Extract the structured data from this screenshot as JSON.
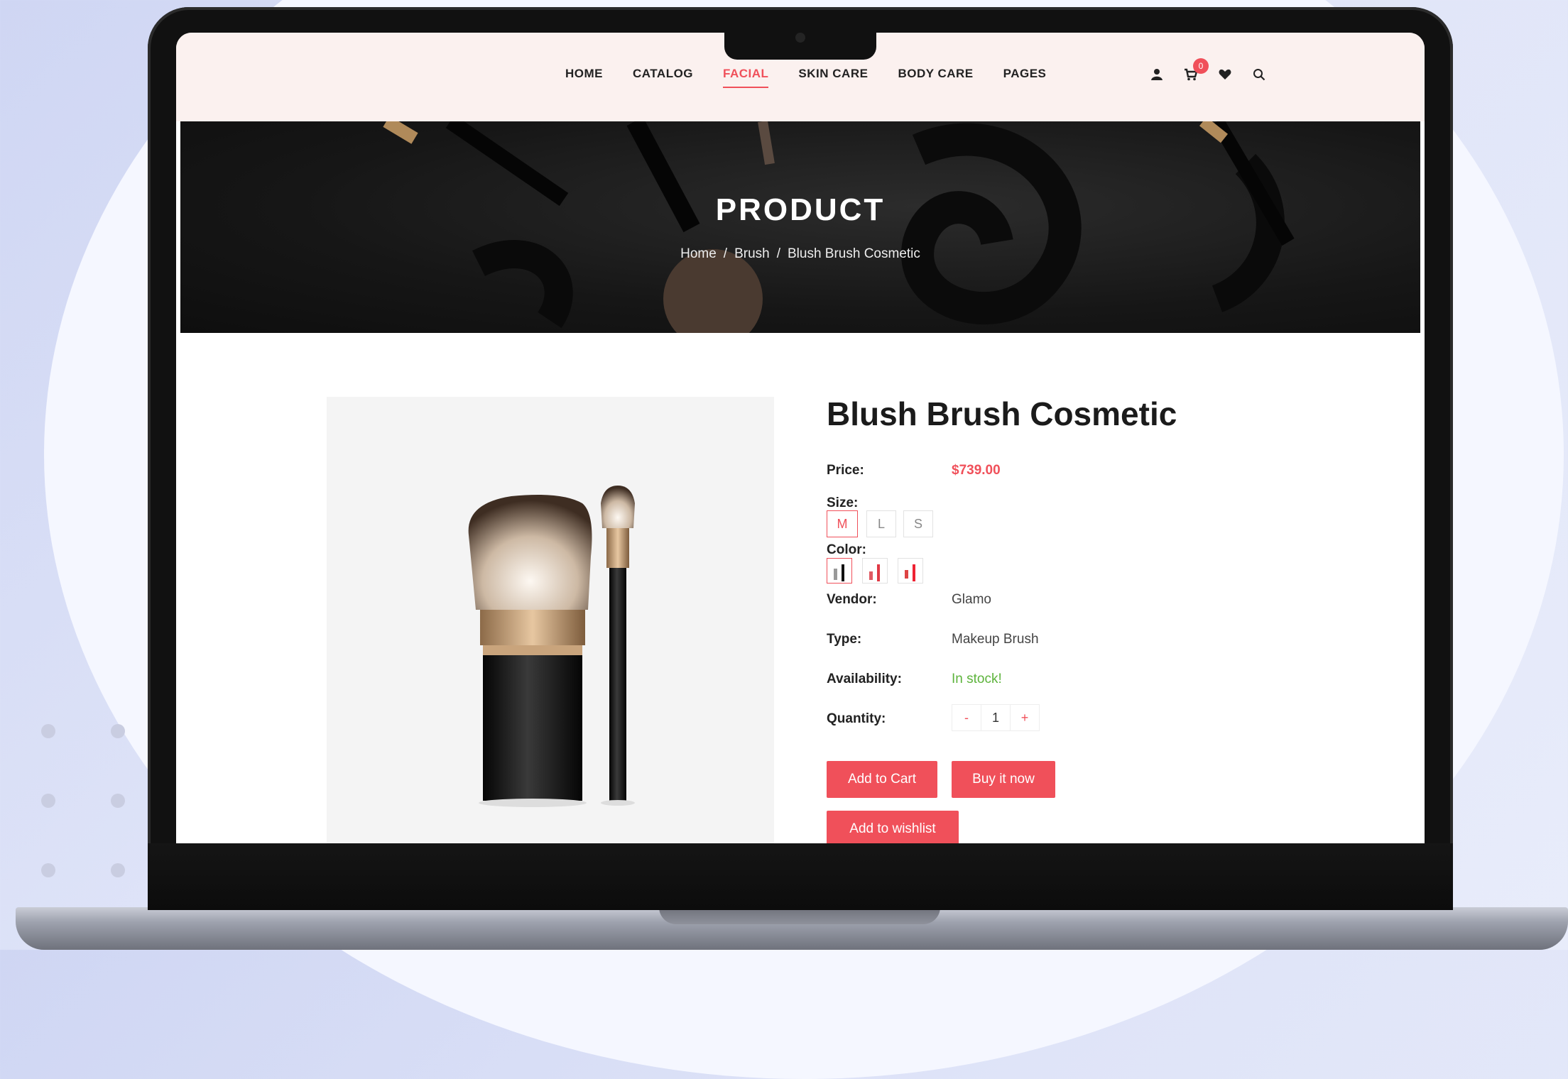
{
  "nav": {
    "items": [
      {
        "label": "HOME"
      },
      {
        "label": "CATALOG"
      },
      {
        "label": "FACIAL",
        "active": true
      },
      {
        "label": "SKIN CARE"
      },
      {
        "label": "BODY CARE"
      },
      {
        "label": "PAGES"
      }
    ],
    "icons": [
      "user-icon",
      "cart-icon",
      "heart-icon",
      "search-icon"
    ],
    "cart_count": "0"
  },
  "banner": {
    "title": "PRODUCT",
    "breadcrumb": [
      "Home",
      "Brush",
      "Blush Brush Cosmetic"
    ],
    "separator": "/"
  },
  "product": {
    "title": "Blush Brush Cosmetic",
    "price_label": "Price:",
    "price": "$739.00",
    "size_label": "Size:",
    "sizes": [
      "M",
      "L",
      "S"
    ],
    "selected_size": "M",
    "color_label": "Color:",
    "vendor_label": "Vendor:",
    "vendor": "Glamo",
    "type_label": "Type:",
    "type": "Makeup Brush",
    "availability_label": "Availability:",
    "availability": "In stock!",
    "quantity_label": "Quantity:",
    "quantity": "1",
    "qty_minus": "-",
    "qty_plus": "+",
    "add_to_cart": "Add to Cart",
    "buy_now": "Buy it now",
    "add_to_wishlist": "Add to wishlist"
  },
  "colors": {
    "accent": "#f0505a",
    "header_bg": "#fbf1ef",
    "in_stock": "#5db33c"
  }
}
